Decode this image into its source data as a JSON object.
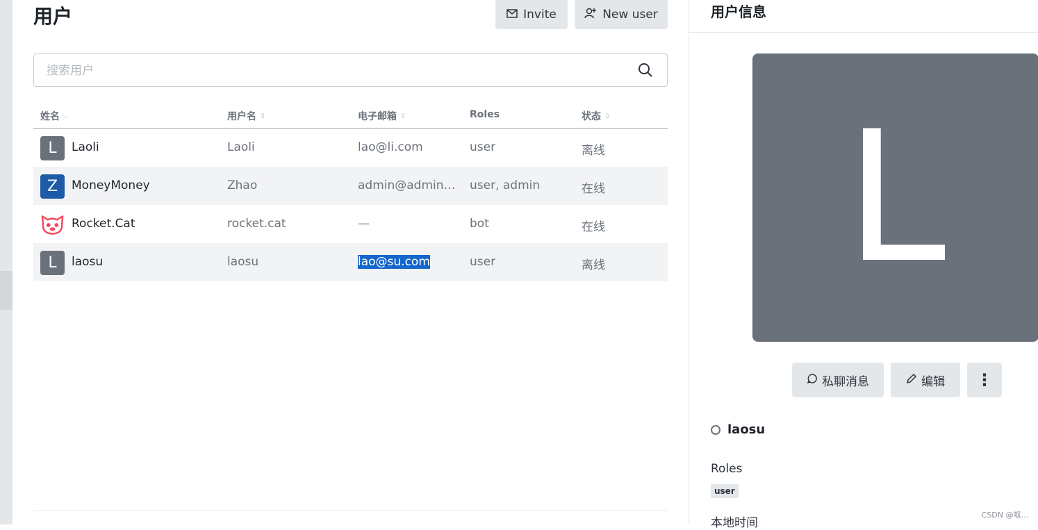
{
  "page": {
    "title": "用户",
    "invite_label": "Invite",
    "new_user_label": "New user"
  },
  "search": {
    "placeholder": "搜索用户"
  },
  "table": {
    "columns": [
      "姓名",
      "用户名",
      "电子邮箱",
      "Roles",
      "状态"
    ],
    "rows": [
      {
        "avatar_letter": "L",
        "avatar_color": "#6b717a",
        "name": "Laoli",
        "username": "Laoli",
        "email": "lao@li.com",
        "roles": "user",
        "status": "离线"
      },
      {
        "avatar_letter": "Z",
        "avatar_color": "#1d5aa8",
        "name": "MoneyMoney",
        "username": "Zhao",
        "email": "admin@admin.c...",
        "roles": "user, admin",
        "status": "在线"
      },
      {
        "avatar_letter": "",
        "avatar_color": "#f5455c",
        "name": "Rocket.Cat",
        "username": "rocket.cat",
        "email": "—",
        "roles": "bot",
        "status": "在线"
      },
      {
        "avatar_letter": "L",
        "avatar_color": "#6b717a",
        "name": "laosu",
        "username": "laosu",
        "email": "lao@su.com",
        "roles": "user",
        "status": "离线"
      }
    ]
  },
  "side": {
    "title": "用户信息",
    "avatar_letter": "L",
    "message_label": "私聊消息",
    "edit_label": "编辑",
    "username": "laosu",
    "roles_label": "Roles",
    "role_tag": "user",
    "local_time_label": "本地时间"
  },
  "watermark": "CSDN @呕..."
}
